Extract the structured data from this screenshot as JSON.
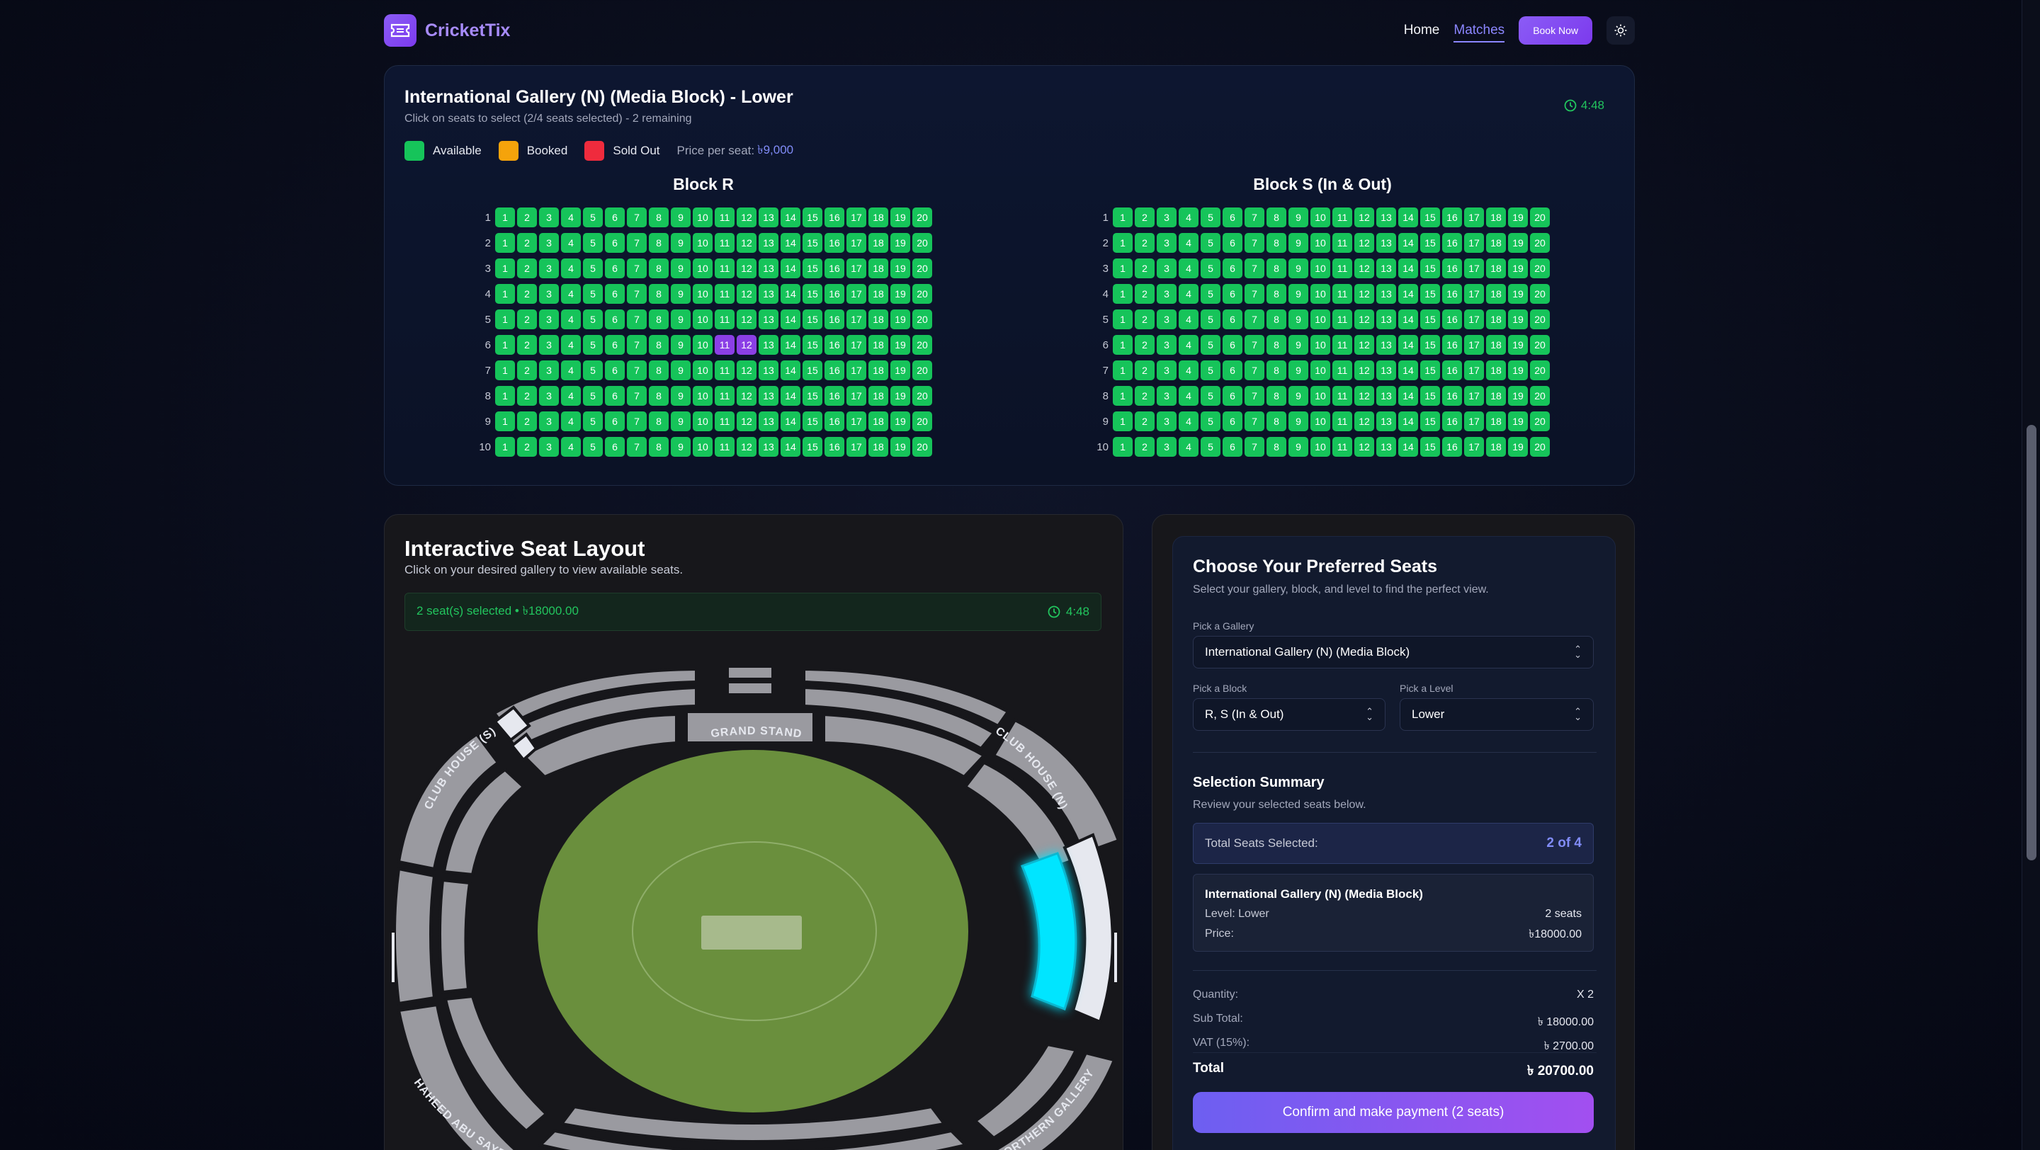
{
  "nav": {
    "brand": "CricketTix",
    "links": [
      "Home",
      "Matches"
    ],
    "active_link": "Matches",
    "book_button": "Book Now",
    "theme_icon": "sun-icon"
  },
  "gallery": {
    "title": "International Gallery (N) (Media Block) - Lower",
    "subtitle": "Click on seats to select (2/4 seats selected) - 2 remaining",
    "timer": "4:48",
    "legend": [
      {
        "label": "Available",
        "color": "#16c45a"
      },
      {
        "label": "Booked",
        "color": "#f5a30b"
      },
      {
        "label": "Sold Out",
        "color": "#ef2b3d"
      }
    ],
    "price_label": "Price per seat:",
    "price_value": "৳9,000",
    "blocks": [
      {
        "name": "Block R",
        "rows": 10,
        "seats_per_row": 20,
        "selected": [
          {
            "row": 6,
            "seat": 11
          },
          {
            "row": 6,
            "seat": 12
          }
        ]
      },
      {
        "name": "Block S (In & Out)",
        "rows": 10,
        "seats_per_row": 20,
        "selected": []
      }
    ]
  },
  "layout": {
    "title": "Interactive Seat Layout",
    "subtitle": "Click on your desired gallery to view available seats.",
    "selection_text": "2 seat(s) selected • ৳18000.00",
    "timer": "4:48",
    "stand_labels": {
      "grand_stand": "GRAND STAND",
      "club_house_s": "CLUB HOUSE (S)",
      "club_house_n": "CLUB HOUSE (N)",
      "shaheed": "SHAHEED ABU SAYED",
      "northern": "NORTHERN GALLERY"
    },
    "colors": {
      "field": "#6a8f3d",
      "stand": "#9a9aa0",
      "selected": "#00e5ff",
      "highlight": "#e6e8ef"
    }
  },
  "booking": {
    "title": "Choose Your Preferred Seats",
    "subtitle": "Select your gallery, block, and level to find the perfect view.",
    "gallery_label": "Pick a Gallery",
    "gallery_value": "International Gallery (N) (Media Block)",
    "block_label": "Pick a Block",
    "block_value": "R, S (In & Out)",
    "level_label": "Pick a Level",
    "level_value": "Lower",
    "summary_title": "Selection Summary",
    "summary_sub": "Review your selected seats below.",
    "total_seats_label": "Total Seats Selected:",
    "total_seats_value": "2 of 4",
    "item_name": "International Gallery (N) (Media Block)",
    "item_level": "Level: Lower",
    "item_seats": "2 seats",
    "item_price_label": "Price:",
    "item_price": "৳18000.00",
    "quantity_label": "Quantity:",
    "quantity_value": "X 2",
    "subtotal_label": "Sub Total:",
    "subtotal_value": "৳ 18000.00",
    "vat_label": "VAT (15%):",
    "vat_value": "৳ 2700.00",
    "total_label": "Total",
    "total_value": "৳ 20700.00",
    "pay_button": "Confirm and make payment (2 seats)"
  }
}
